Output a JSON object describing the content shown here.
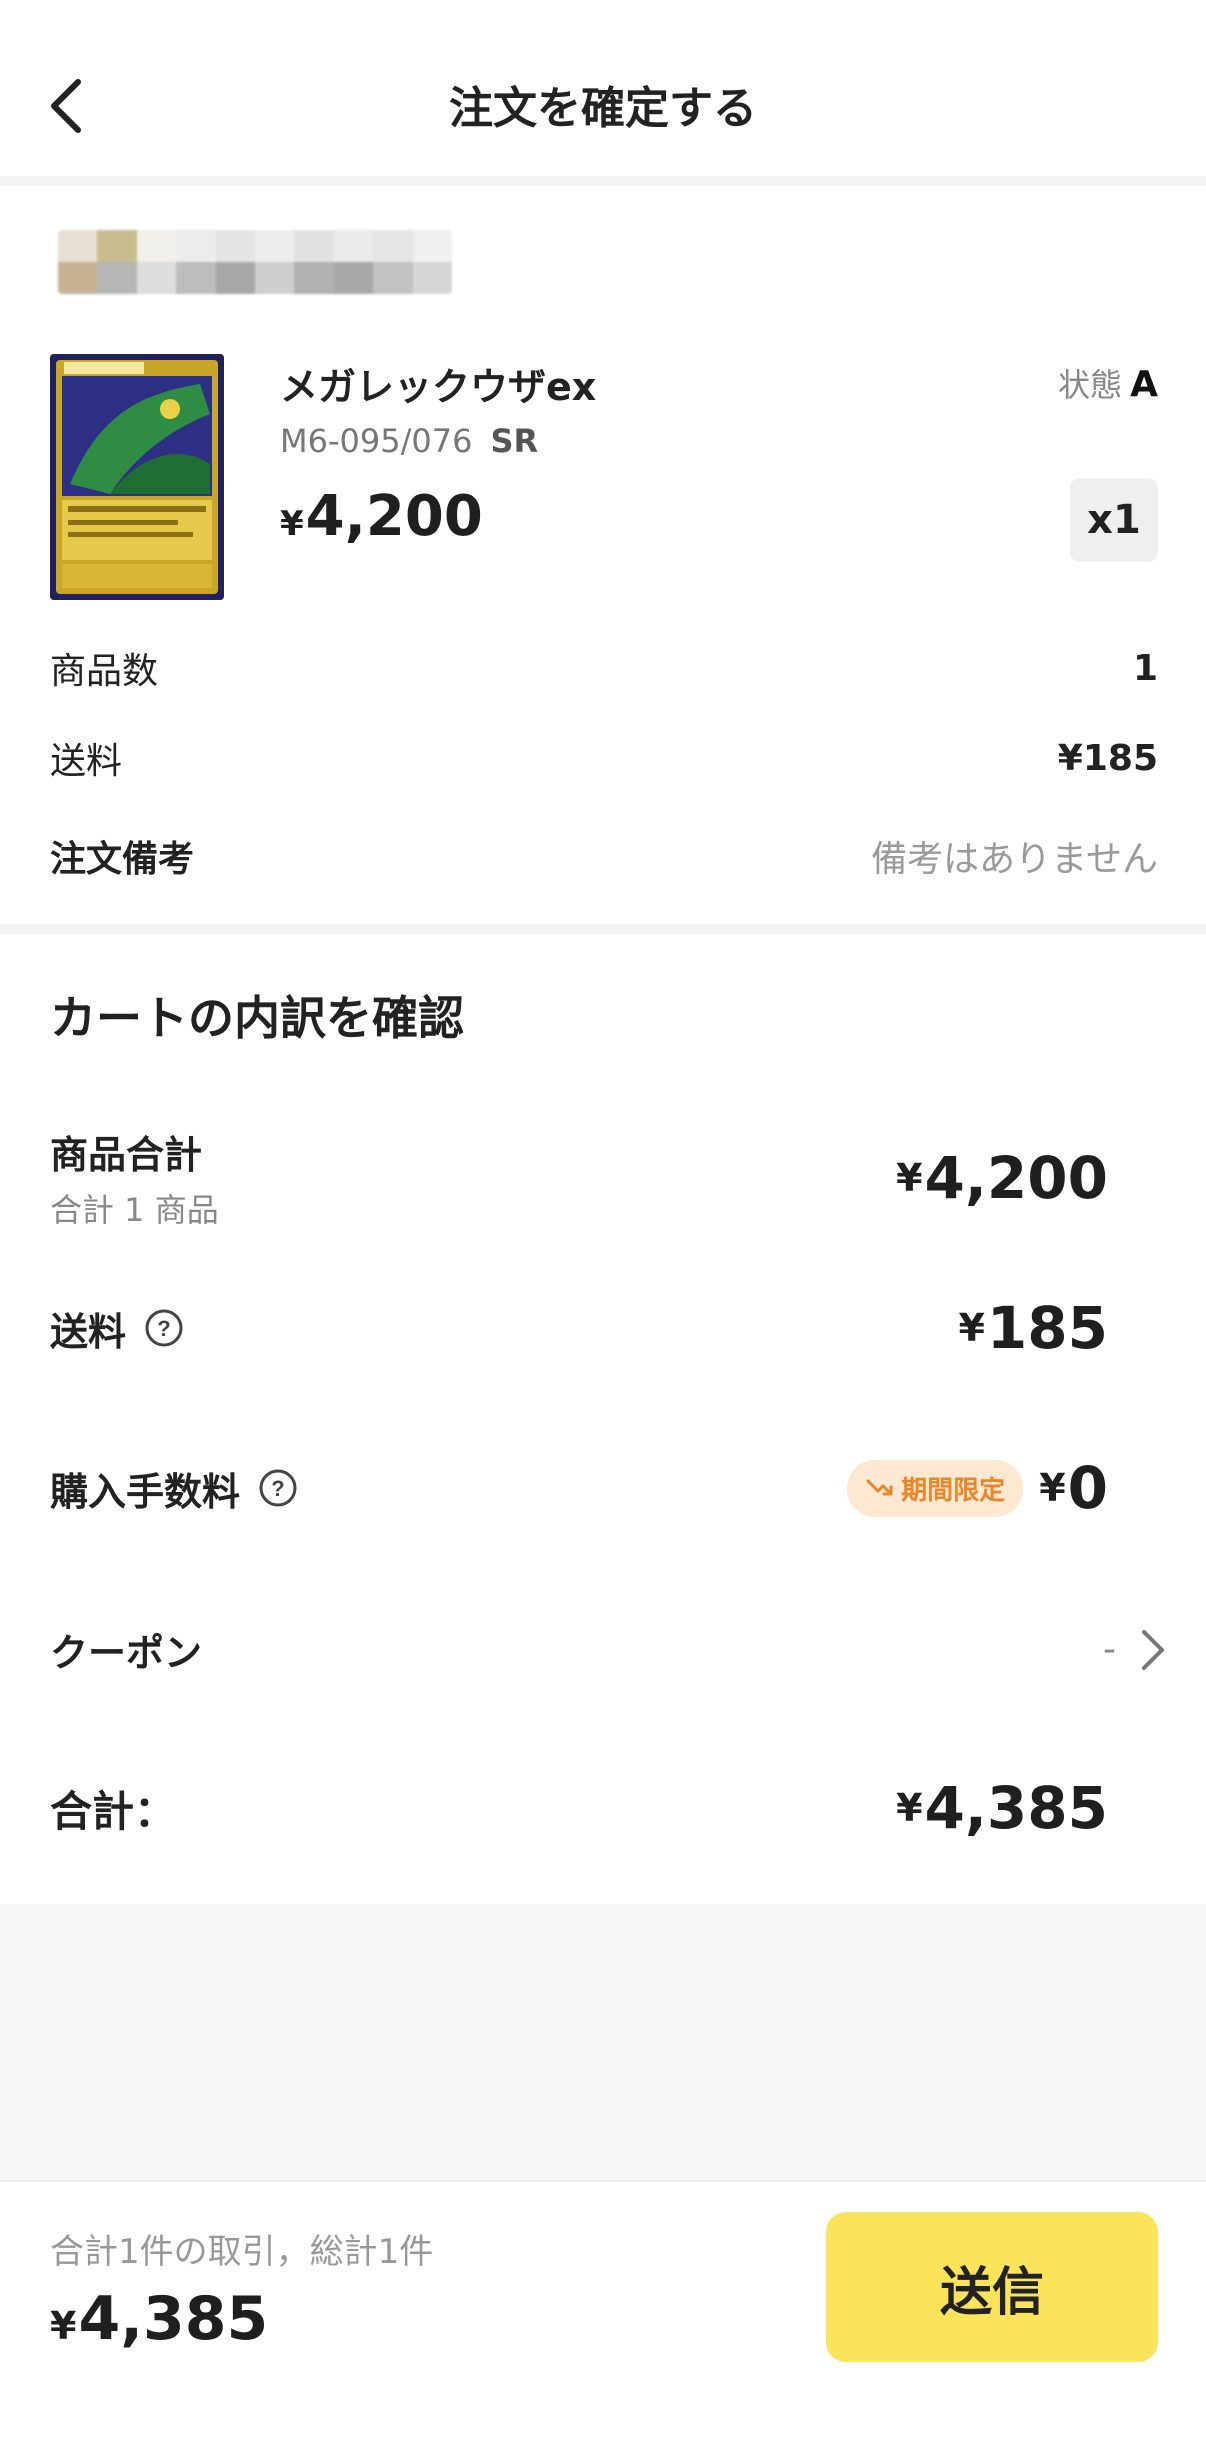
{
  "header": {
    "title": "注文を確定する"
  },
  "product": {
    "name": "メガレックウザex",
    "code": "M6-095/076",
    "rarity": "SR",
    "currency": "¥",
    "price": "4,200",
    "condition_label": "状態",
    "condition_value": "A",
    "quantity": "x1"
  },
  "order_info": {
    "item_count_label": "商品数",
    "item_count_value": "1",
    "shipping_label": "送料",
    "shipping_value": "¥185",
    "note_label": "注文備考",
    "note_value": "備考はありません"
  },
  "breakdown": {
    "title": "カートの内訳を確認",
    "subtotal_label": "商品合計",
    "subtotal_sub": "合計 1 商品",
    "subtotal_value": "4,200",
    "shipping_label": "送料",
    "shipping_value": "185",
    "fee_label": "購入手数料",
    "fee_badge": "期間限定",
    "fee_value": "0",
    "coupon_label": "クーポン",
    "coupon_value": "-",
    "total_label": "合計：",
    "total_value": "4,385",
    "currency": "¥"
  },
  "bottom": {
    "summary": "合計1件の取引，総計1件",
    "currency": "¥",
    "total": "4,385",
    "submit_label": "送信"
  },
  "colors": {
    "accent_button": "#fbe45a",
    "promo_badge_bg": "#fde8d2",
    "promo_badge_text": "#e8862a"
  }
}
